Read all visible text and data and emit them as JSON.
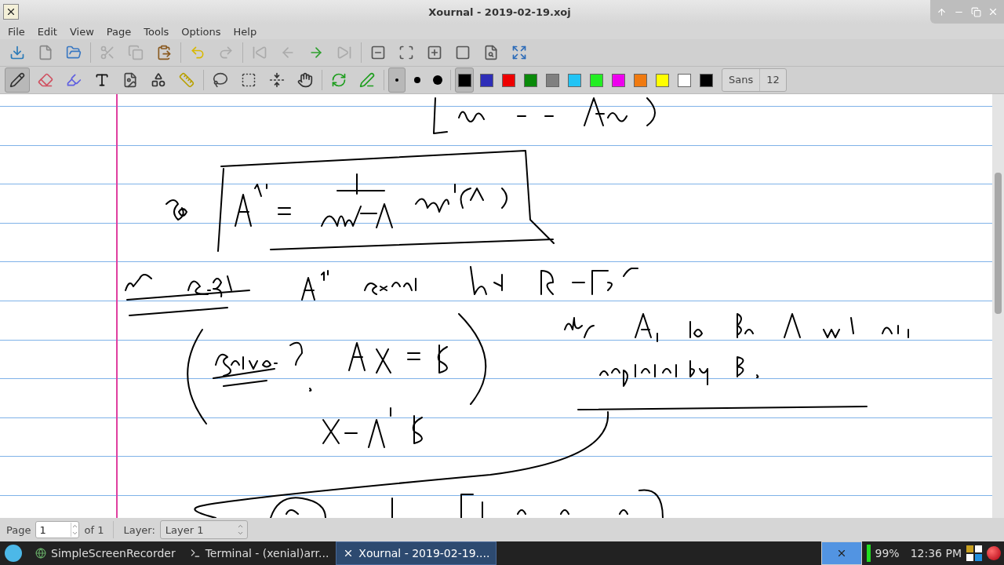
{
  "window": {
    "title": "Xournal - 2019-02-19.xoj"
  },
  "menu": [
    "File",
    "Edit",
    "View",
    "Page",
    "Tools",
    "Options",
    "Help"
  ],
  "main_toolbar": [
    {
      "kind": "save",
      "disabled": false
    },
    {
      "kind": "new",
      "disabled": false
    },
    {
      "kind": "open",
      "disabled": false
    },
    {
      "kind": "cut",
      "disabled": true
    },
    {
      "kind": "copy",
      "disabled": true
    },
    {
      "kind": "paste",
      "disabled": false
    },
    {
      "kind": "undo",
      "disabled": false
    },
    {
      "kind": "redo",
      "disabled": true
    },
    {
      "kind": "first",
      "disabled": true
    },
    {
      "kind": "previous",
      "disabled": true
    },
    {
      "kind": "next",
      "disabled": false
    },
    {
      "kind": "last",
      "disabled": true
    },
    {
      "kind": "zoom_out",
      "disabled": false
    },
    {
      "kind": "zoom_fit",
      "disabled": false
    },
    {
      "kind": "zoom_in",
      "disabled": false
    },
    {
      "kind": "zoom_normal",
      "disabled": false
    },
    {
      "kind": "page_width",
      "disabled": false
    },
    {
      "kind": "fullscreen",
      "disabled": false
    }
  ],
  "tools": [
    {
      "kind": "pen",
      "selected": true
    },
    {
      "kind": "eraser",
      "selected": false
    },
    {
      "kind": "highlighter",
      "selected": false
    },
    {
      "kind": "text",
      "selected": false
    },
    {
      "kind": "image",
      "selected": false
    },
    {
      "kind": "shapes",
      "selected": false
    },
    {
      "kind": "ruler",
      "selected": false
    },
    {
      "kind": "lasso",
      "selected": false
    },
    {
      "kind": "rect_select",
      "selected": false
    },
    {
      "kind": "vertical_space",
      "selected": false
    },
    {
      "kind": "hand",
      "selected": false
    },
    {
      "kind": "default_tool",
      "selected": false
    },
    {
      "kind": "default_pen",
      "selected": false
    }
  ],
  "pen_sizes": [
    {
      "kind": "fine",
      "selected": true
    },
    {
      "kind": "medium",
      "selected": false
    },
    {
      "kind": "thick",
      "selected": false
    }
  ],
  "colors": [
    {
      "color": "#000000",
      "selected": true
    },
    {
      "color": "#2e2eb8",
      "selected": false
    },
    {
      "color": "#ee0000",
      "selected": false
    },
    {
      "color": "#0a8a0a",
      "selected": false
    },
    {
      "color": "#808080",
      "selected": false
    },
    {
      "color": "#22c4f5",
      "selected": false
    },
    {
      "color": "#22ee22",
      "selected": false
    },
    {
      "color": "#ee00ee",
      "selected": false
    },
    {
      "color": "#f07a10",
      "selected": false
    },
    {
      "color": "#ffff00",
      "selected": false
    },
    {
      "color": "#ffffff",
      "selected": false
    },
    {
      "color": "#000001",
      "selected": false
    }
  ],
  "font": {
    "name": "Sans",
    "size": "12"
  },
  "status_bar": {
    "page_label": "Page",
    "page_value": "1",
    "page_total": "of 1",
    "layer_label": "Layer:",
    "layer_value": "Layer 1"
  },
  "taskbar": {
    "tasks": [
      {
        "kind": "recorder",
        "label": "SimpleScreenRecorder",
        "selected": false
      },
      {
        "kind": "terminal",
        "label": "Terminal - (xenial)arr...",
        "selected": false
      },
      {
        "kind": "xournal",
        "label": "Xournal - 2019-02-19....",
        "selected": true
      }
    ],
    "battery": "99%",
    "clock": "12:36 PM"
  }
}
